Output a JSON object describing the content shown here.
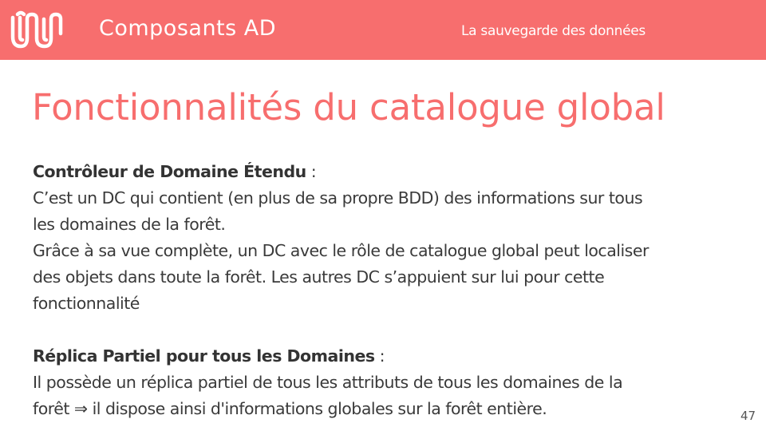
{
  "header": {
    "title": "Composants AD",
    "subtitle": "La sauvegarde des données",
    "background_color": "#f76e6e",
    "logo_icon": "wave-logo-icon"
  },
  "slide": {
    "title": "Fonctionnalités du catalogue global",
    "title_color": "#f76e6e",
    "page_number": "47"
  },
  "sections": [
    {
      "heading": "Contrôleur de Domaine Étendu",
      "heading_suffix": " :",
      "lines": [
        "C’est un DC qui contient (en plus de sa propre BDD) des informations sur tous",
        "les domaines de la forêt.",
        "Grâce à sa vue complète, un DC avec le rôle de catalogue global peut localiser",
        "des objets dans toute la forêt. Les autres DC s’appuient sur lui pour cette",
        "fonctionnalité"
      ]
    },
    {
      "heading": "Réplica Partiel pour tous les Domaines",
      "heading_suffix": " :",
      "lines": [
        "Il possède un réplica partiel de tous les attributs de tous les domaines de la",
        "forêt ⇒ il dispose ainsi d'informations globales sur la forêt entière."
      ]
    }
  ]
}
